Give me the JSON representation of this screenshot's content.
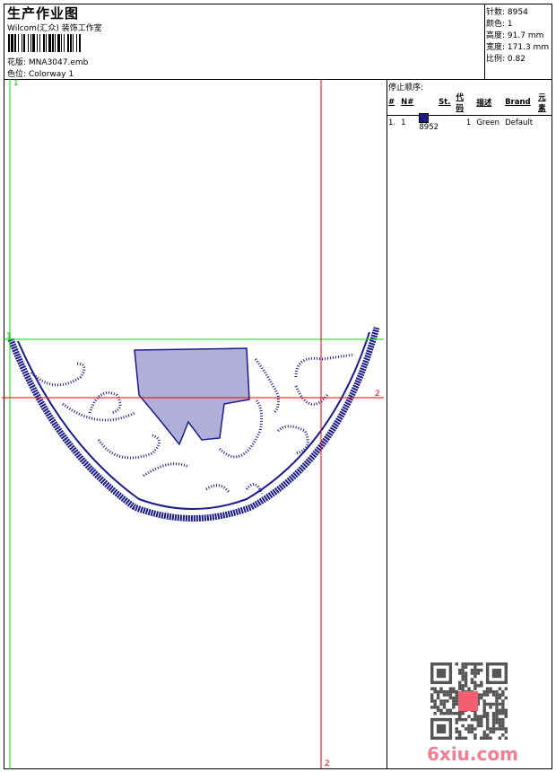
{
  "header": {
    "title": "生产作业图",
    "company": "Wilcom(汇众) 装饰工作室",
    "design_label": "花版:",
    "design_value": "MNA3047.emb",
    "colorway_label": "色位:",
    "colorway_value": "Colorway 1"
  },
  "stats": [
    {
      "label": "针数:",
      "value": "8954"
    },
    {
      "label": "颜色:",
      "value": "1"
    },
    {
      "label": "高度:",
      "value": "91.7 mm"
    },
    {
      "label": "宽度:",
      "value": "171.3 mm"
    },
    {
      "label": "比例:",
      "value": "0.82"
    }
  ],
  "stop_sequence": {
    "title": "停止顺序:",
    "columns": [
      "#",
      "N#",
      "St.",
      "代码",
      "描述",
      "Brand",
      "元素"
    ],
    "rows": [
      {
        "index": "1.",
        "n": "1",
        "color": "#1a1a8c",
        "stitches": "8952",
        "code": "1",
        "description": "Green",
        "brand": "Default",
        "element": ""
      }
    ]
  },
  "canvas": {
    "marker_green_1": "1",
    "marker_green_2": "1",
    "marker_red_1": "2",
    "marker_red_2": "2",
    "thread_color": "#1a1a8c",
    "guide_green": "#00dd00",
    "guide_red": "#ee0000"
  },
  "watermark": {
    "site": "6xiu.com",
    "seal": "段图服装"
  }
}
